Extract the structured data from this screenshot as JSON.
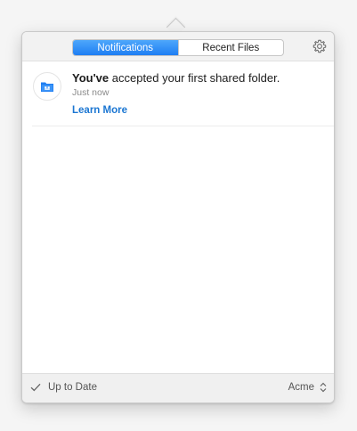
{
  "header": {
    "tabs": [
      {
        "label": "Notifications",
        "active": true
      },
      {
        "label": "Recent Files",
        "active": false
      }
    ],
    "settings_icon": "gear-icon"
  },
  "notifications": [
    {
      "icon": "shared-folder-icon",
      "title_bold": "You've",
      "title_rest": " accepted your first shared folder.",
      "time": "Just now",
      "link": "Learn More"
    }
  ],
  "footer": {
    "status_icon": "checkmark-icon",
    "status": "Up to Date",
    "account": "Acme",
    "account_icon": "up-down-chevron-icon"
  },
  "colors": {
    "accent": "#1e7ef3",
    "link": "#1b76d2"
  }
}
